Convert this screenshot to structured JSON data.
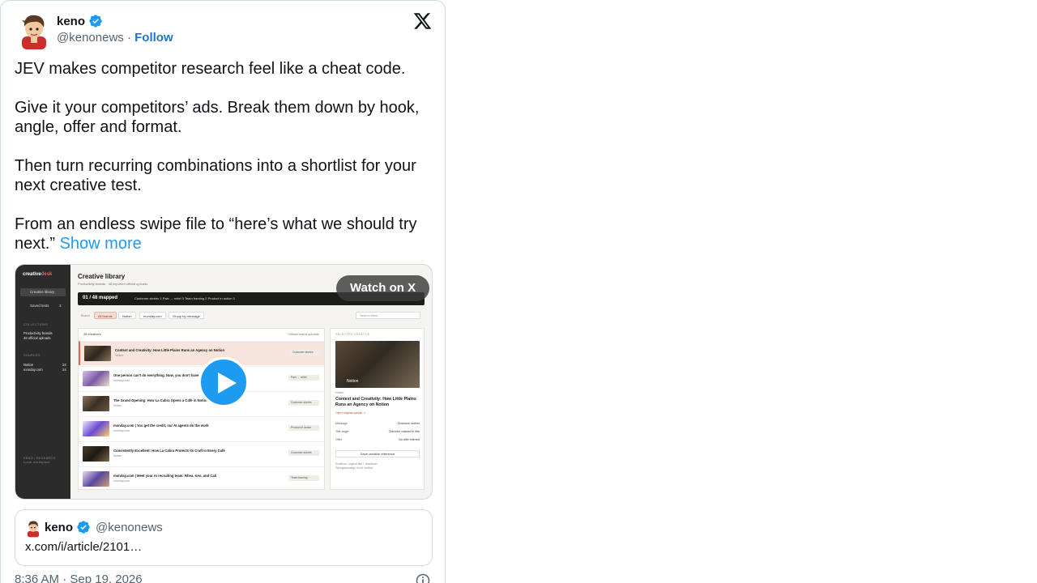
{
  "author": {
    "name": "keno",
    "handle": "@kenonews",
    "separator": "·",
    "follow_label": "Follow"
  },
  "tweet": {
    "paragraphs": [
      "JEV makes competitor research feel like a cheat code.",
      "Give it your competitors’ ads. Break them down by hook, angle, offer and format.",
      "Then turn recurring combinations into a shortlist for your next creative test."
    ],
    "last_paragraph": "From an endless swipe file to “here’s what we should try next.”",
    "show_more_label": "Show more"
  },
  "media": {
    "watch_label": "Watch on X",
    "app": {
      "logo_main": "creative",
      "logo_accent": "desk",
      "nav": [
        {
          "label": "Creative library",
          "count": ""
        },
        {
          "label": "Saved tests",
          "count": "3"
        }
      ],
      "collections_label": "COLLECTIONS",
      "collections": [
        "Productivity brands",
        "48 official uploads"
      ],
      "sources_label": "SOURCES",
      "sources": [
        {
          "label": "Notion",
          "count": "24"
        },
        {
          "label": "monday.com",
          "count": "24"
        }
      ],
      "footer": [
        "KENO / RESEARCH",
        "Local workspace"
      ],
      "title": "Creative library",
      "subtitle": "Productivity brands · 48 imported official uploads",
      "mapped_label": "01 / 48 mapped",
      "mapped_stats": "Customer stories  1     Pain → relief  3     Team framing  2     Product in action  3",
      "filter_brand_label": "Brand",
      "filters": [
        "All brands",
        "Notion",
        "monday.com",
        "Group by message"
      ],
      "search_placeholder": "Search titles…",
      "list_count": "48 creatives",
      "list_source": "Official brand uploads",
      "rows": [
        {
          "title": "Context and Creativity: How Little Plains Runs an Agency on Notion",
          "brand": "Notion",
          "tag": "Customer stories"
        },
        {
          "title": "One person can't do everything. Now, you don't have to",
          "brand": "monday.com",
          "tag": "Pain → relief"
        },
        {
          "title": "The Grand Opening: How La Cabra Opens a Café in Notion",
          "brand": "Notion",
          "tag": "Customer stories"
        },
        {
          "title": "monday.com | You get the credit, our AI agents do the work",
          "brand": "monday.com",
          "tag": "Product in action"
        },
        {
          "title": "Consistently Excellent: How La Cabra Protects its Craft in Every Café",
          "brand": "Notion",
          "tag": "Customer stories"
        },
        {
          "title": "monday.com | Meet your AI recruiting team: Rhea, Ken, and Cali",
          "brand": "monday.com",
          "tag": "Team framing"
        }
      ],
      "detail": {
        "section_label": "SELECTED CREATIVE",
        "image_brandline": "Notion",
        "brand": "Notion",
        "title": "Context and Creativity: How Little Plains Runs an Agency on Notion",
        "link": "Open original upload ↗",
        "fields": [
          {
            "k": "Message",
            "v": "Customer stories"
          },
          {
            "k": "Title angle",
            "v": "Outcome claimed in title"
          },
          {
            "k": "Offer",
            "v": "No offer inferred"
          }
        ],
        "save_label": "Save creative reference",
        "note_1": "Evidence: original title + thumbnail",
        "note_2": "Pacing/message is not verified"
      }
    }
  },
  "quote": {
    "name": "keno",
    "handle": "@kenonews",
    "link_text": "x.com/i/article/2101…"
  },
  "timestamp": "8:36 AM · Sep 19, 2026",
  "colors": {
    "verified": "#1d9bf0",
    "follow": "#1d75c3",
    "accent": "#e0684c",
    "link": "#1d9bf0"
  }
}
